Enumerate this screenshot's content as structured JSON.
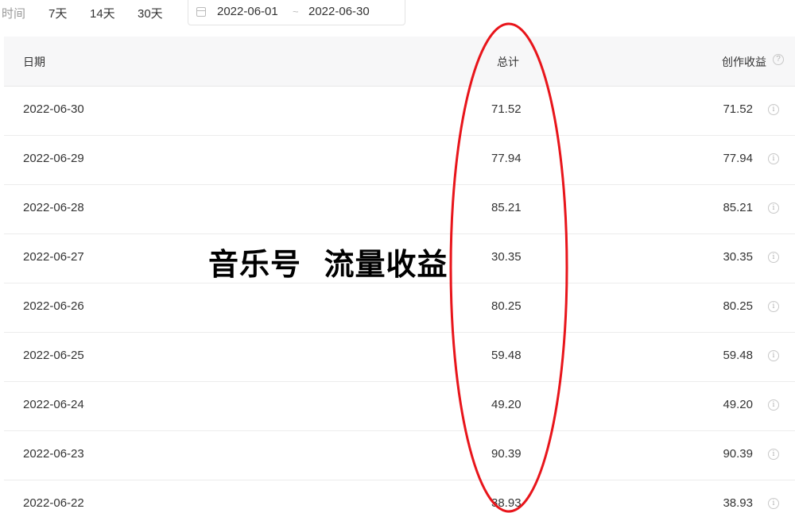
{
  "filter": {
    "label": "时间",
    "ranges": [
      "7天",
      "14天",
      "30天"
    ],
    "date_start": "2022-06-01",
    "date_separator": "~",
    "date_end": "2022-06-30"
  },
  "table": {
    "headers": {
      "date": "日期",
      "total": "总计",
      "creation": "创作收益",
      "help_icon": "?"
    },
    "info_icon": "i",
    "rows": [
      {
        "date": "2022-06-30",
        "total": "71.52",
        "creation": "71.52"
      },
      {
        "date": "2022-06-29",
        "total": "77.94",
        "creation": "77.94"
      },
      {
        "date": "2022-06-28",
        "total": "85.21",
        "creation": "85.21"
      },
      {
        "date": "2022-06-27",
        "total": "30.35",
        "creation": "30.35"
      },
      {
        "date": "2022-06-26",
        "total": "80.25",
        "creation": "80.25"
      },
      {
        "date": "2022-06-25",
        "total": "59.48",
        "creation": "59.48"
      },
      {
        "date": "2022-06-24",
        "total": "49.20",
        "creation": "49.20"
      },
      {
        "date": "2022-06-23",
        "total": "90.39",
        "creation": "90.39"
      },
      {
        "date": "2022-06-22",
        "total": "38.93",
        "creation": "38.93"
      }
    ]
  },
  "overlay": {
    "caption": "音乐号  流量收益",
    "ellipse_color": "#e8151b"
  }
}
